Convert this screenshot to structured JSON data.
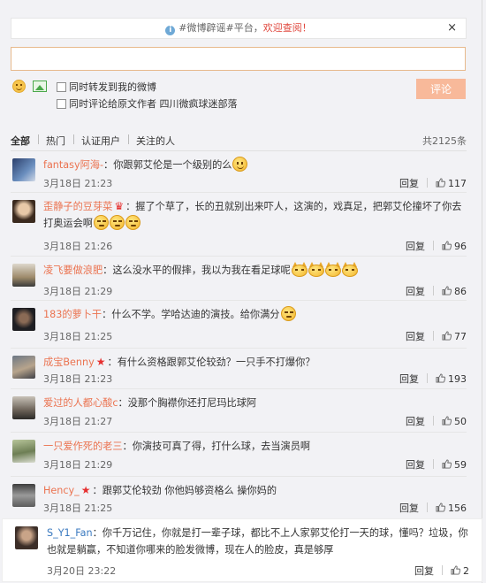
{
  "notice": {
    "text": "#微博辟谣#平台，",
    "welcome": "欢迎查阅！",
    "close": "×"
  },
  "compose": {
    "value": "",
    "forward_label": "同时转发到我的微博",
    "comment_to_author_label": "同时评论给原文作者 四川微疯球迷部落",
    "submit_label": "评论"
  },
  "tabs": {
    "items": [
      "全部",
      "热门",
      "认证用户",
      "关注的人"
    ],
    "total": "共2125条"
  },
  "colors": {
    "username": "#eb7350",
    "accent_button": "#f8b99a",
    "welcome_text": "#e0483e"
  },
  "comments": [
    {
      "user": "fantasy阿海-",
      "text": "：你跟郭艾伦是一个级别的么",
      "time": "3月18日 21:23",
      "reply": "回复",
      "likes": "117"
    },
    {
      "user": "歪静子的豆芽菜",
      "text": "：握了个草了，长的丑就别出来吓人，这演的，戏真足，把郭艾伦撞坏了你去打奥运会啊",
      "time": "3月18日 21:26",
      "reply": "回复",
      "likes": "96"
    },
    {
      "user": "凌飞要做浪肥",
      "text": "：这么没水平的假摔，我以为我在看足球呢",
      "time": "3月18日 21:29",
      "reply": "回复",
      "likes": "86"
    },
    {
      "user": "183的萝卜干",
      "text": "：什么不学。学哈达迪的演技。给你满分",
      "time": "3月18日 21:25",
      "reply": "回复",
      "likes": "77"
    },
    {
      "user": "成宝Benny",
      "text": "：有什么资格跟郭艾伦较劲？一只手不打爆你？",
      "time": "3月18日 21:23",
      "reply": "回复",
      "likes": "193"
    },
    {
      "user": "爱过的人都心酸c",
      "text": "：没那个胸襟你还打尼玛比球阿",
      "time": "3月18日 21:27",
      "reply": "回复",
      "likes": "50"
    },
    {
      "user": "一只爱作死的老三",
      "text": "：你演技可真了得，打什么球，去当演员啊",
      "time": "3月18日 21:29",
      "reply": "回复",
      "likes": "59"
    },
    {
      "user": "Hency_",
      "text": "：跟郭艾伦较劲 你他妈够资格么 操你妈的",
      "time": "3月18日 21:25",
      "reply": "回复",
      "likes": "156"
    },
    {
      "user": "S_Y1_Fan",
      "text": "：你千万记住，你就是打一辈子球，都比不上人家郭艾伦打一天的球，懂吗？垃圾，你也就是躺赢，不知道你哪来的脸发微博，现在人的脸皮，真是够厚",
      "time": "3月20日 23:22",
      "reply": "回复",
      "likes": "2"
    }
  ]
}
